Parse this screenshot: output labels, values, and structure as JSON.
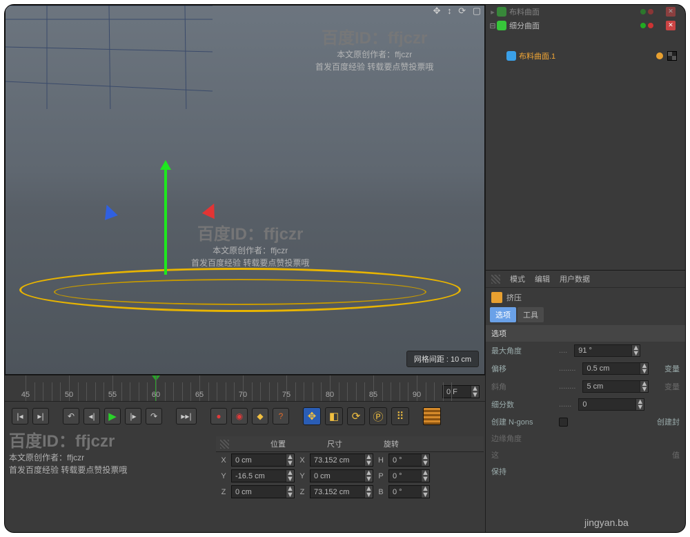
{
  "viewport": {
    "grid_hint": "网格间距 : 10 cm",
    "nav_icons": "✥ ↕ ⟳ ▢"
  },
  "objects": {
    "items": [
      {
        "name": "布料曲面",
        "expandable": true,
        "icon": "green",
        "x": true
      },
      {
        "name": "细分曲面",
        "expandable": true,
        "icon": "green",
        "x": true
      },
      {
        "name": "布料曲面.1",
        "expandable": false,
        "icon": "blue",
        "selected": true,
        "tag": true
      }
    ]
  },
  "attr": {
    "menu": {
      "mode": "模式",
      "edit": "编辑",
      "userdata": "用户数据"
    },
    "tool": "挤压",
    "tabs": {
      "options": "选项",
      "tool": "工具"
    },
    "section": "选项",
    "max_angle": {
      "label": "最大角度",
      "value": "91 °"
    },
    "offset": {
      "label": "偏移",
      "value": "0.5 cm",
      "extra": "变量"
    },
    "bevel": {
      "label": "斜角",
      "value": "5 cm",
      "extra": "变量"
    },
    "subdiv": {
      "label": "细分数",
      "value": "0"
    },
    "ngons": {
      "label": "创建 N-gons",
      "extra": "创建封"
    },
    "edge": {
      "label": "边缘角度"
    },
    "misc1": {
      "label": "这",
      "extra": "值"
    },
    "misc2": {
      "label": "保持"
    }
  },
  "timeline": {
    "ticks": [
      "45",
      "50",
      "55",
      "60",
      "65",
      "70",
      "75",
      "80",
      "85",
      "90"
    ],
    "frame_field": "0 F"
  },
  "coord": {
    "headers": {
      "pos": "位置",
      "size": "尺寸",
      "rot": "旋转"
    },
    "rows": [
      {
        "ax": "X",
        "pos": "0 cm",
        "sizeax": "X",
        "size": "73.152 cm",
        "rotax": "H",
        "rot": "0 °"
      },
      {
        "ax": "Y",
        "pos": "-16.5 cm",
        "sizeax": "Y",
        "size": "0 cm",
        "rotax": "P",
        "rot": "0 °"
      },
      {
        "ax": "Z",
        "pos": "0 cm",
        "sizeax": "Z",
        "size": "73.152 cm",
        "rotax": "B",
        "rot": "0 °"
      }
    ]
  },
  "watermark": {
    "title": "百度ID：ffjczr",
    "l1": "本文原创作者：ffjczr",
    "l2": "首发百度经验 转载要点赞投票哦",
    "url": "jingyan.ba"
  }
}
